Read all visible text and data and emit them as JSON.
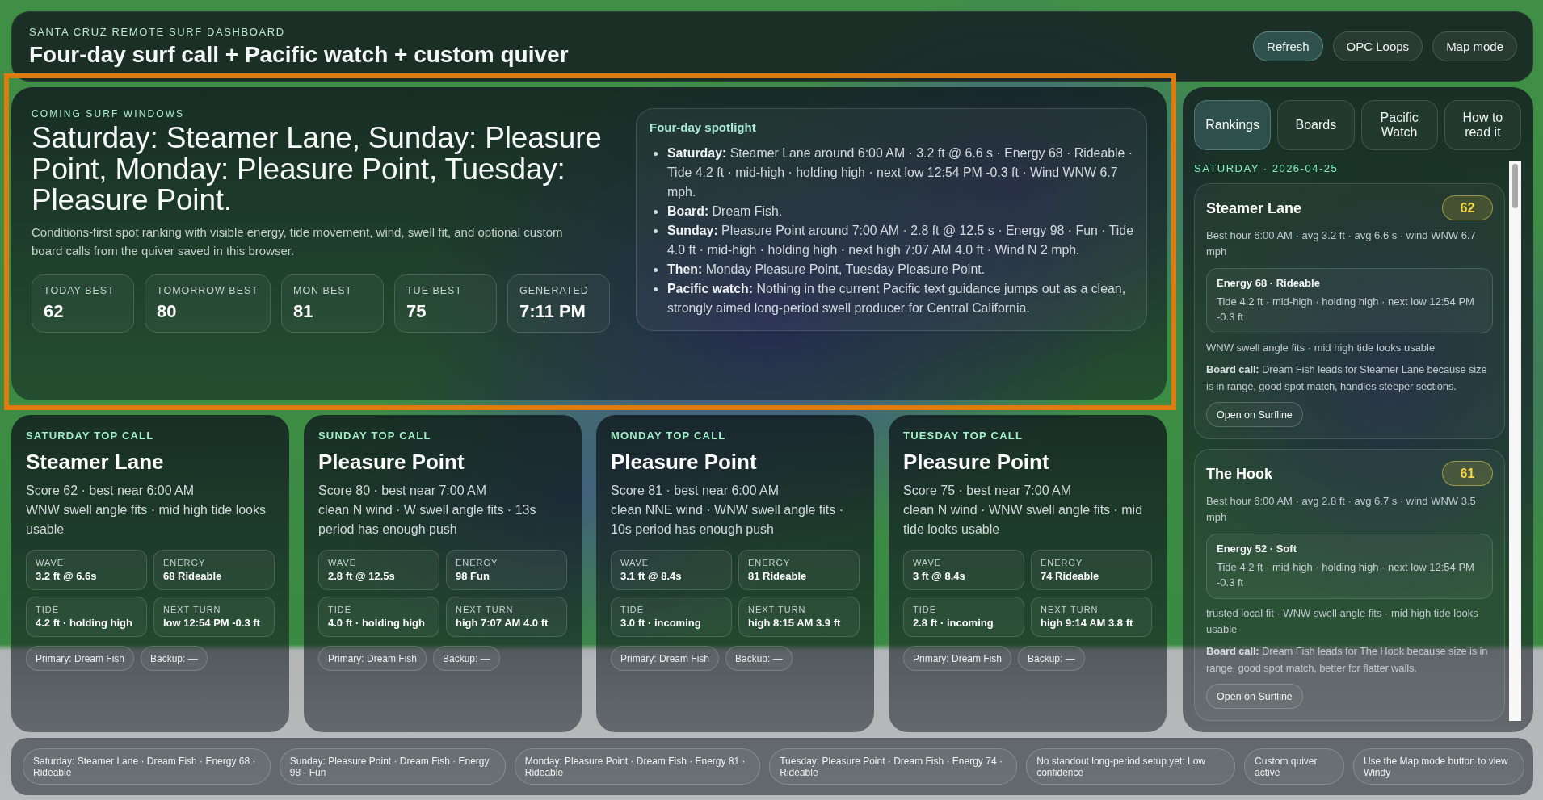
{
  "header": {
    "eyebrow": "SANTA CRUZ REMOTE SURF DASHBOARD",
    "title": "Four-day surf call + Pacific watch + custom quiver",
    "buttons": [
      {
        "label": "Refresh",
        "kind": "primary"
      },
      {
        "label": "OPC Loops",
        "kind": "secondary"
      },
      {
        "label": "Map mode",
        "kind": "secondary"
      }
    ]
  },
  "hero": {
    "highlighted": true,
    "eyebrow": "COMING SURF WINDOWS",
    "headline": "Saturday: Steamer Lane, Sunday: Pleasure Point, Monday: Pleasure Point, Tuesday: Pleasure Point.",
    "description": "Conditions-first spot ranking with visible energy, tide movement, wind, swell fit, and optional custom board calls from the quiver saved in this browser.",
    "stats": [
      {
        "label": "TODAY BEST",
        "value": "62"
      },
      {
        "label": "TOMORROW BEST",
        "value": "80"
      },
      {
        "label": "MON BEST",
        "value": "81"
      },
      {
        "label": "TUE BEST",
        "value": "75"
      },
      {
        "label": "GENERATED",
        "value": "7:11 PM"
      }
    ],
    "spotlight": {
      "title": "Four-day spotlight",
      "items": [
        "**Saturday:** Steamer Lane around 6:00 AM · 3.2 ft @ 6.6 s · Energy 68 · Rideable · Tide 4.2 ft · mid-high · holding high · next low 12:54 PM -0.3 ft · Wind WNW 6.7 mph.",
        "**Board:** Dream Fish.",
        "**Sunday:** Pleasure Point around 7:00 AM · 2.8 ft @ 12.5 s · Energy 98 · Fun · Tide 4.0 ft · mid-high · holding high · next high 7:07 AM 4.0 ft · Wind N 2 mph.",
        "**Then:** Monday Pleasure Point, Tuesday Pleasure Point.",
        "**Pacific watch:** Nothing in the current Pacific text guidance jumps out as a clean, strongly aimed long-period swell producer for Central California."
      ]
    }
  },
  "top_calls": [
    {
      "eyebrow": "SATURDAY TOP CALL",
      "spot": "Steamer Lane",
      "score_line": "Score 62 · best near 6:00 AM",
      "notes": "WNW swell angle fits · mid high tide looks usable",
      "metrics": [
        {
          "label": "WAVE",
          "value": "3.2 ft @ 6.6s"
        },
        {
          "label": "ENERGY",
          "value": "68 Rideable"
        },
        {
          "label": "TIDE",
          "value": "4.2 ft · holding high"
        },
        {
          "label": "NEXT TURN",
          "value": "low 12:54 PM -0.3 ft"
        }
      ],
      "boards": [
        "Primary: Dream Fish",
        "Backup: —"
      ]
    },
    {
      "eyebrow": "SUNDAY TOP CALL",
      "spot": "Pleasure Point",
      "score_line": "Score 80 · best near 7:00 AM",
      "notes": "clean N wind · W swell angle fits · 13s period has enough push",
      "metrics": [
        {
          "label": "WAVE",
          "value": "2.8 ft @ 12.5s"
        },
        {
          "label": "ENERGY",
          "value": "98 Fun"
        },
        {
          "label": "TIDE",
          "value": "4.0 ft · holding high"
        },
        {
          "label": "NEXT TURN",
          "value": "high 7:07 AM 4.0 ft"
        }
      ],
      "boards": [
        "Primary: Dream Fish",
        "Backup: —"
      ]
    },
    {
      "eyebrow": "MONDAY TOP CALL",
      "spot": "Pleasure Point",
      "score_line": "Score 81 · best near 6:00 AM",
      "notes": "clean NNE wind · WNW swell angle fits · 10s period has enough push",
      "metrics": [
        {
          "label": "WAVE",
          "value": "3.1 ft @ 8.4s"
        },
        {
          "label": "ENERGY",
          "value": "81 Rideable"
        },
        {
          "label": "TIDE",
          "value": "3.0 ft · incoming"
        },
        {
          "label": "NEXT TURN",
          "value": "high 8:15 AM 3.9 ft"
        }
      ],
      "boards": [
        "Primary: Dream Fish",
        "Backup: —"
      ]
    },
    {
      "eyebrow": "TUESDAY TOP CALL",
      "spot": "Pleasure Point",
      "score_line": "Score 75 · best near 7:00 AM",
      "notes": "clean N wind · WNW swell angle fits · mid tide looks usable",
      "metrics": [
        {
          "label": "WAVE",
          "value": "3 ft @ 8.4s"
        },
        {
          "label": "ENERGY",
          "value": "74 Rideable"
        },
        {
          "label": "TIDE",
          "value": "2.8 ft · incoming"
        },
        {
          "label": "NEXT TURN",
          "value": "high 9:14 AM 3.8 ft"
        }
      ],
      "boards": [
        "Primary: Dream Fish",
        "Backup: —"
      ]
    }
  ],
  "sidebar": {
    "tabs": [
      {
        "label": "Rankings",
        "selected": true
      },
      {
        "label": "Boards",
        "selected": false
      },
      {
        "label": "Pacific Watch",
        "selected": false
      },
      {
        "label": "How to read it",
        "selected": false
      }
    ],
    "day_heading": "SATURDAY · 2026-04-25",
    "spots": [
      {
        "name": "Steamer Lane",
        "score": "62",
        "summary": "Best hour 6:00 AM · avg 3.2 ft · avg 6.6 s · wind WNW 6.7 mph",
        "energy": "Energy 68 · Rideable",
        "tide": "Tide 4.2 ft · mid-high · holding high · next low 12:54 PM -0.3 ft",
        "notes": "WNW swell angle fits · mid high tide looks usable",
        "board_call": "**Board call:** Dream Fish leads for Steamer Lane because size is in range, good spot match, handles steeper sections.",
        "link": "Open on Surfline"
      },
      {
        "name": "The Hook",
        "score": "61",
        "summary": "Best hour 6:00 AM · avg 2.8 ft · avg 6.7 s · wind WNW 3.5 mph",
        "energy": "Energy 52 · Soft",
        "tide": "Tide 4.2 ft · mid-high · holding high · next low 12:54 PM -0.3 ft",
        "notes": "trusted local fit · WNW swell angle fits · mid high tide looks usable",
        "board_call": "**Board call:** Dream Fish leads for The Hook because size is in range, good spot match, better for flatter walls.",
        "link": "Open on Surfline"
      }
    ]
  },
  "status_chips": [
    "Saturday: Steamer Lane · Dream Fish · Energy 68 · Rideable",
    "Sunday: Pleasure Point · Dream Fish · Energy 98 · Fun",
    "Monday: Pleasure Point · Dream Fish · Energy 81 · Rideable",
    "Tuesday: Pleasure Point · Dream Fish · Energy 74 · Rideable",
    "No standout long-period setup yet: Low confidence",
    "Custom quiver active",
    "Use the Map mode button to view Windy"
  ]
}
